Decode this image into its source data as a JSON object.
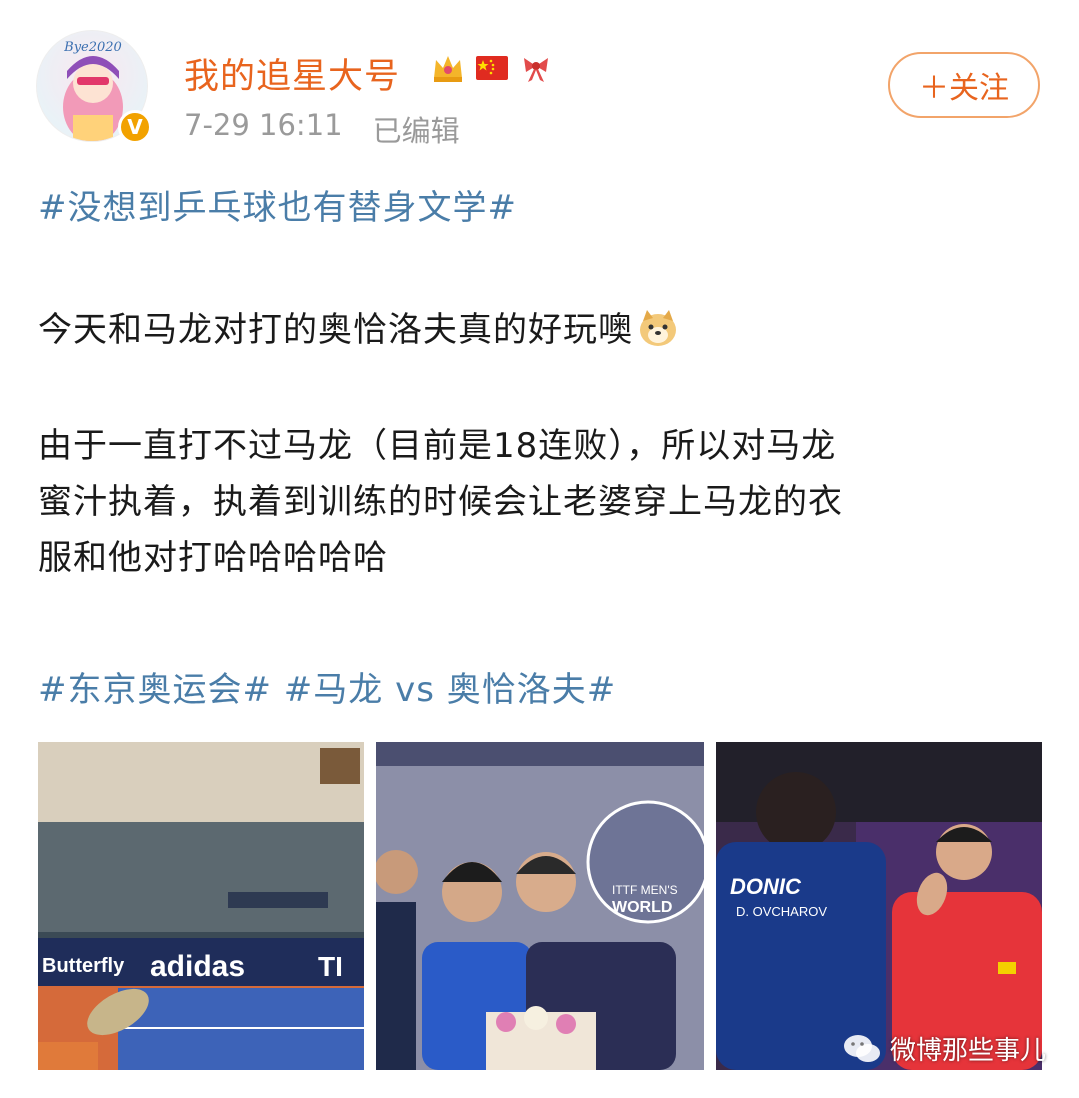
{
  "post": {
    "username": "我的追星大号",
    "time": "7-29 16:11",
    "edited": "已编辑",
    "follow_label": "＋关注",
    "topic1": "#没想到乒乓球也有替身文学#",
    "line1": "今天和马龙对打的奥恰洛夫真的好玩噢",
    "para_lines": [
      "由于一直打不过马龙（目前是18连败），所以对马龙",
      "蜜汁执着，执着到训练的时候会让老婆穿上马龙的衣",
      "服和他对打哈哈哈哈哈"
    ],
    "topic2": "#东京奥运会#",
    "topic3": "#马龙 vs 奥恰洛夫#"
  },
  "avatar": {
    "signature": "Bye2020"
  },
  "images": {
    "photo1": {
      "banner1": "Butterfly",
      "banner2": "adidas",
      "banner3": "TI"
    },
    "photo2": {
      "text1": "ITTF MEN'S",
      "text2": "WORLD"
    },
    "photo3": {
      "jersey_brand": "DONIC",
      "jersey_name": "D. OVCHAROV"
    }
  },
  "watermark": {
    "text": "微博那些事儿"
  },
  "colors": {
    "accent": "#e8641e",
    "topic": "#4a7da8",
    "meta": "#9a9a9a"
  }
}
